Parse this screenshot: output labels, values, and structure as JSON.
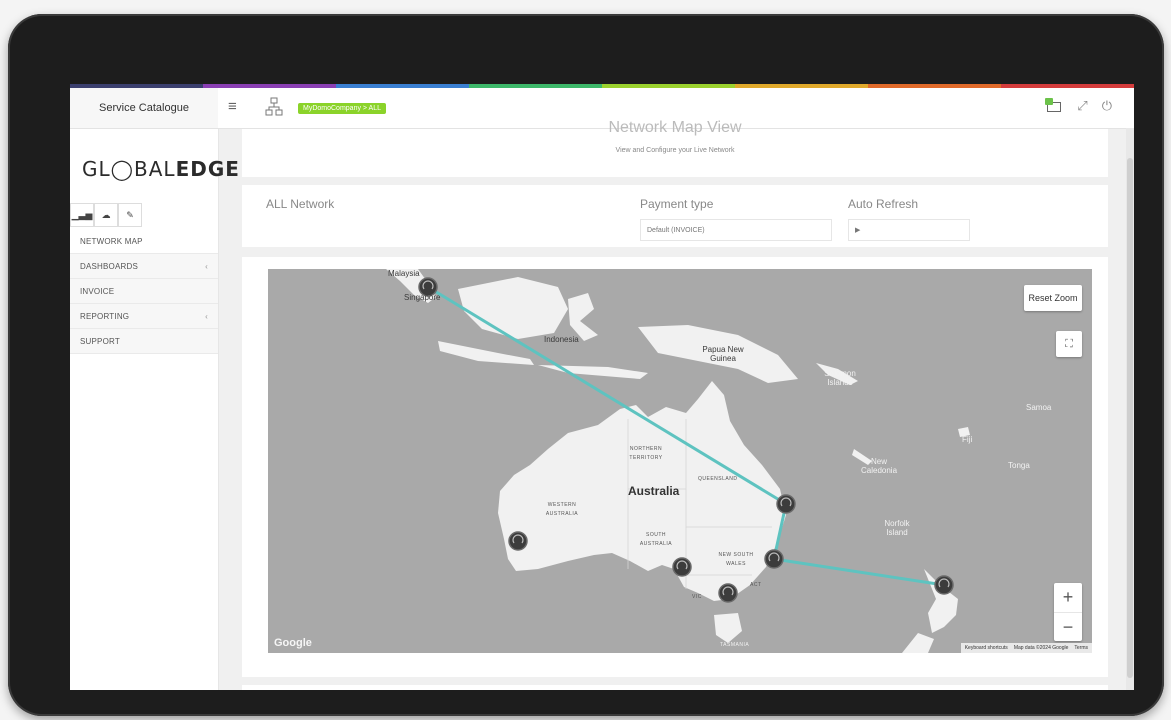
{
  "header": {
    "service_catalogue": "Service Catalogue",
    "company_badge": "MyDomoCompany > ALL",
    "color_bar": [
      "#3b3f6e",
      "#8a3fb3",
      "#3a7fd1",
      "#3db86a",
      "#9bd12e",
      "#e0a92b",
      "#e06a2a",
      "#d43c3c"
    ]
  },
  "sidebar": {
    "logo_pre": "GL",
    "logo_ring": "◯",
    "logo_mid": "BAL",
    "logo_bold": "EDGE",
    "tabs": [
      "bar-chart-icon",
      "cloud-icon",
      "wrench-icon"
    ],
    "items": [
      {
        "label": "NETWORK MAP",
        "chevron": ""
      },
      {
        "label": "DASHBOARDS",
        "chevron": "‹"
      },
      {
        "label": "INVOICE",
        "chevron": ""
      },
      {
        "label": "REPORTING",
        "chevron": "‹"
      },
      {
        "label": "SUPPORT",
        "chevron": ""
      }
    ]
  },
  "main": {
    "title": "Network Map View",
    "subtitle": "View and Configure your Live Network",
    "filters": {
      "network_label": "ALL Network",
      "payment_label": "Payment type",
      "payment_value": "Default (INVOICE)",
      "refresh_label": "Auto Refresh",
      "refresh_value": "▶"
    }
  },
  "map": {
    "reset_zoom": "Reset Zoom",
    "zoom_in": "+",
    "zoom_out": "−",
    "google": "Google",
    "footer": {
      "shortcuts": "Keyboard shortcuts",
      "data": "Map data ©2024 Google",
      "terms": "Terms"
    },
    "labels": {
      "malaysia": "Malaysia",
      "singapore": "Singapore",
      "indonesia": "Indonesia",
      "png": "Papua New Guinea",
      "solomon": "Solomon Islands",
      "samoa": "Samoa",
      "fiji": "Fiji",
      "tonga": "Tonga",
      "new_caledonia": "New Caledonia",
      "norfolk": "Norfolk Island",
      "australia": "Australia",
      "nt": "NORTHERN TERRITORY",
      "qld": "QUEENSLAND",
      "wa": "WESTERN AUSTRALIA",
      "sa": "SOUTH AUSTRALIA",
      "nsw": "NEW SOUTH WALES",
      "act": "ACT",
      "vic": "VIC",
      "tas": "TASMANIA"
    },
    "colors": {
      "route": "#5ec3c0",
      "node": "#3c3c3c",
      "land": "#f1f1f1",
      "sea": "#a9a9a9"
    }
  }
}
